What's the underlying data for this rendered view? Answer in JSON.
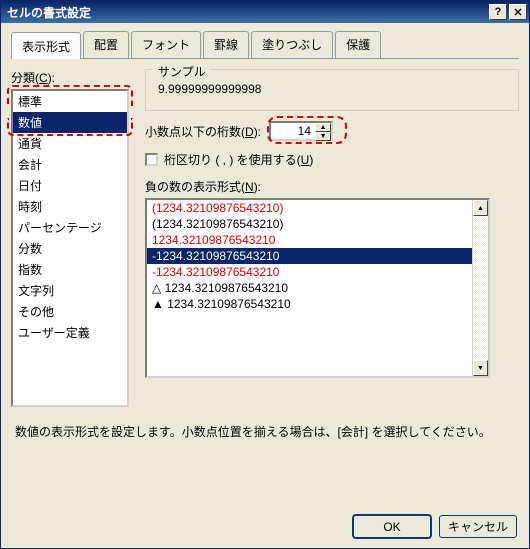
{
  "title": "セルの書式設定",
  "tabs": [
    "表示形式",
    "配置",
    "フォント",
    "罫線",
    "塗りつぶし",
    "保護"
  ],
  "activeTab": 0,
  "category": {
    "label": "分類",
    "key": "C",
    "items": [
      "標準",
      "数値",
      "通貨",
      "会計",
      "日付",
      "時刻",
      "パーセンテージ",
      "分数",
      "指数",
      "文字列",
      "その他",
      "ユーザー定義"
    ],
    "selectedIndex": 1
  },
  "sample": {
    "label": "サンプル",
    "value": "9.99999999999998"
  },
  "decimals": {
    "label": "小数点以下の桁数",
    "key": "D",
    "value": "14"
  },
  "thousands": {
    "label": "桁区切り ( , ) を使用する",
    "key": "U",
    "checked": false
  },
  "negative": {
    "label": "負の数の表示形式",
    "key": "N",
    "items": [
      {
        "text": "(1234.32109876543210)",
        "color": "red",
        "sel": false
      },
      {
        "text": "(1234.32109876543210)",
        "color": "",
        "sel": false
      },
      {
        "text": "1234.32109876543210",
        "color": "red",
        "sel": false
      },
      {
        "text": "-1234.32109876543210",
        "color": "",
        "sel": true
      },
      {
        "text": "-1234.32109876543210",
        "color": "red",
        "sel": false
      },
      {
        "text": "△ 1234.32109876543210",
        "color": "",
        "sel": false
      },
      {
        "text": "▲ 1234.32109876543210",
        "color": "",
        "sel": false
      }
    ]
  },
  "description": "数値の表示形式を設定します。小数点位置を揃える場合は、[会計] を選択してください。",
  "buttons": {
    "ok": "OK",
    "cancel": "キャンセル"
  },
  "titlebarHelp": "?",
  "titlebarClose": "✕"
}
